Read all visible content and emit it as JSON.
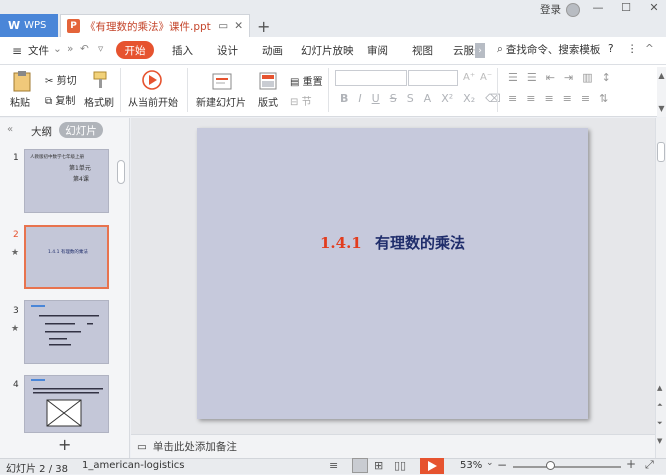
{
  "titlebar": {
    "app_tab": "WPS",
    "doc_tab": "《有理数的乘法》课件.ppt",
    "login": "登录"
  },
  "menubar": {
    "file": "文件",
    "tabs": [
      "开始",
      "插入",
      "设计",
      "动画",
      "幻灯片放映",
      "审阅",
      "视图",
      "云服务"
    ],
    "search": "查找命令、搜索模板"
  },
  "ribbon": {
    "paste": "粘贴",
    "cut": "剪切",
    "copy": "复制",
    "format_painter": "格式刷",
    "from_current": "从当前开始",
    "new_slide": "新建幻灯片",
    "layout": "版式",
    "reset": "重置",
    "section": "节"
  },
  "leftpanel": {
    "outline_tab": "大纲",
    "slides_tab": "幻灯片",
    "thumbs": [
      {
        "num": "1",
        "lines": [
          "人教版初中数学七年级上册",
          "第1单元",
          "第4课"
        ]
      },
      {
        "num": "2",
        "lines": [
          "1.4.1 有理数的乘法"
        ]
      },
      {
        "num": "3",
        "lines": []
      },
      {
        "num": "4",
        "lines": []
      }
    ]
  },
  "slide": {
    "number": "1.4.1",
    "title": "有理数的乘法"
  },
  "notes": {
    "placeholder": "单击此处添加备注"
  },
  "statusbar": {
    "slide_counter": "幻灯片 2 / 38",
    "theme": "1_american-logistics",
    "zoom": "53%",
    "zoom_fraction": 0.35
  },
  "colors": {
    "accent": "#e6532f",
    "slide_bg": "#c6c9dc",
    "slide_number": "#e23c1e",
    "slide_title": "#1f2d6b",
    "wps_blue": "#4a86d8"
  }
}
